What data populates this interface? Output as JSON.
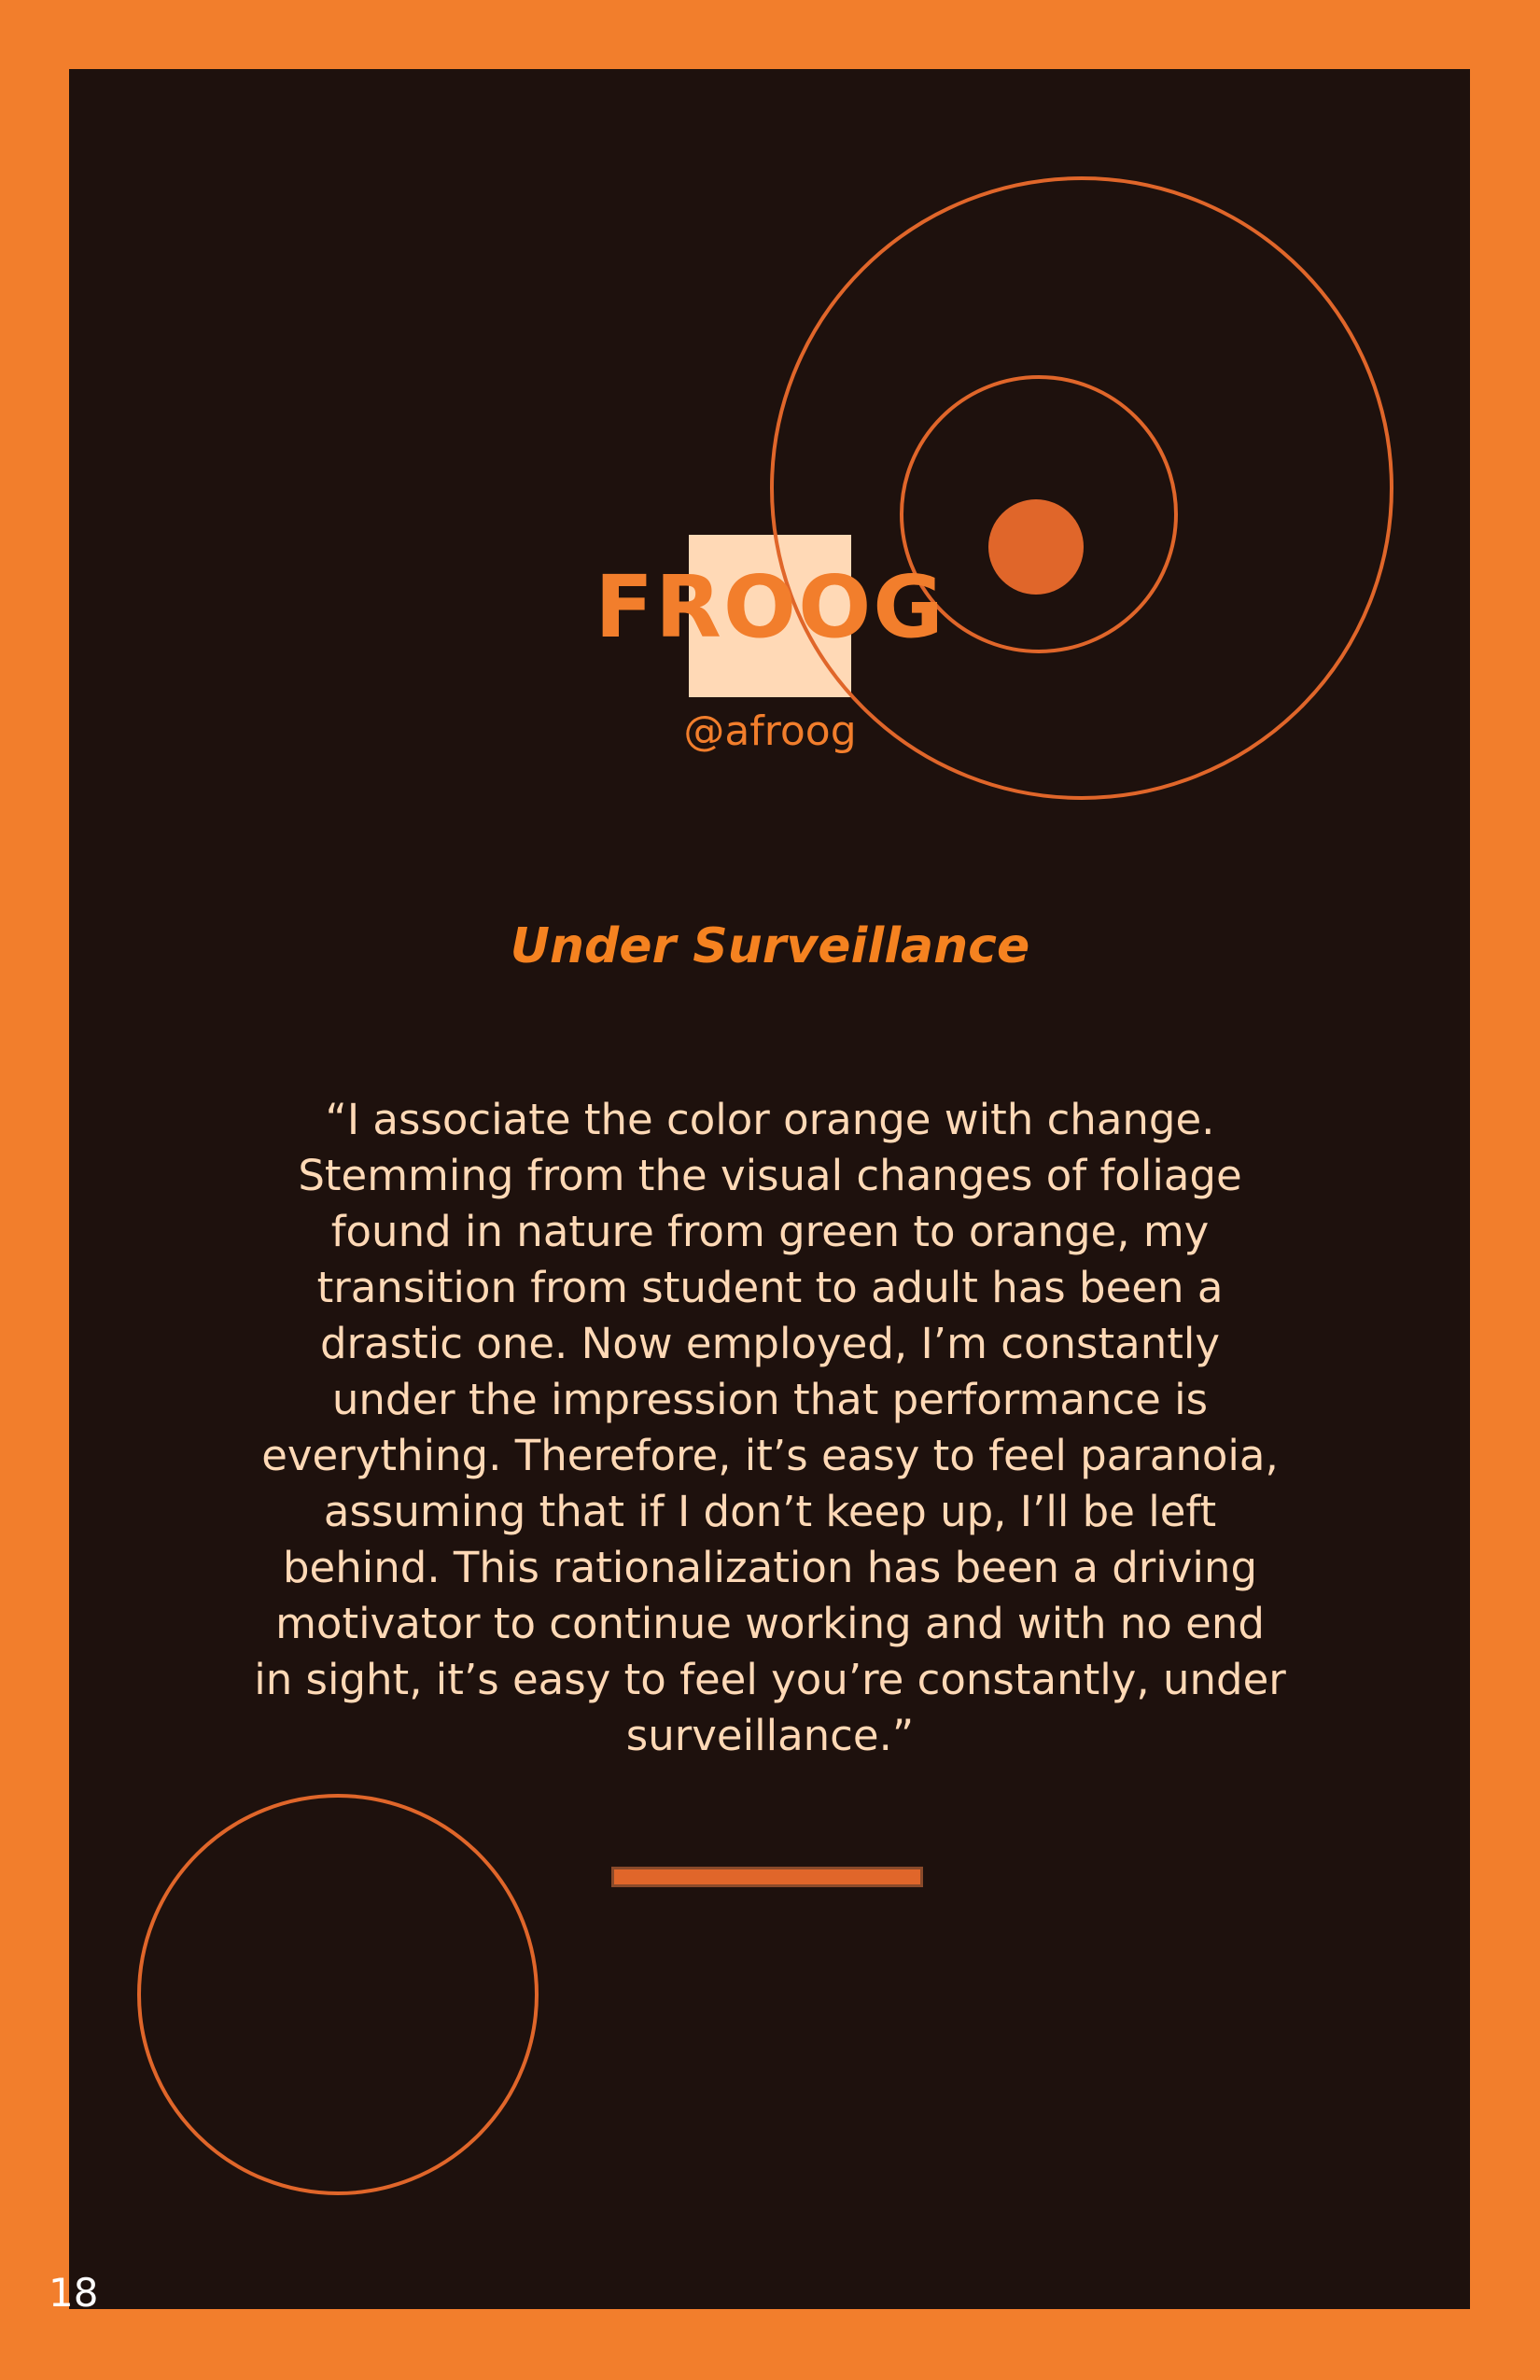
{
  "artist": {
    "name": "FROOG",
    "handle": "@afroog"
  },
  "piece": {
    "title": "Under Surveillance",
    "quote": "“I associate the color orange with change. Stemming from the visual changes of foliage found in nature from green to orange, my transition from student to adult has been a drastic one. Now employed, I’m constantly under the impression that performance is everything. Therefore, it’s easy to feel paranoia, assuming that if I don’t keep up, I’ll be left behind. This rationalization has been a driving motivator to continue working and with no end in sight, it’s easy to feel you’re constantly, under surveillance.”"
  },
  "page": {
    "number": "18"
  },
  "colors": {
    "border_orange": "#f27e2c",
    "panel_dark": "#1e110d",
    "accent_orange": "#e0662a",
    "text_peach": "#ffd9b6"
  }
}
